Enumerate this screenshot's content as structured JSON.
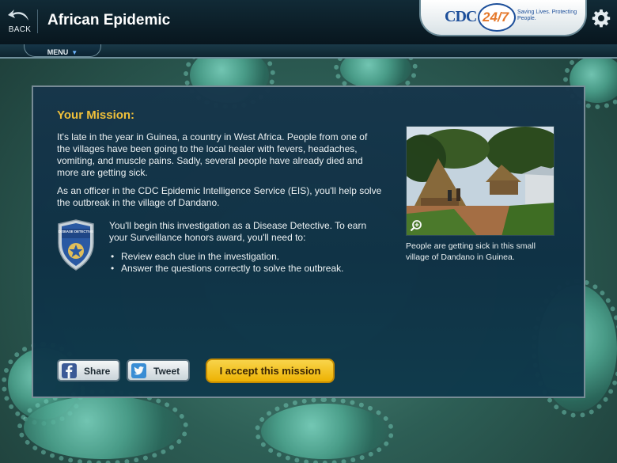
{
  "header": {
    "back_label": "BACK",
    "title": "African Epidemic",
    "logo": {
      "cdc": "CDC",
      "hours": "24/7",
      "tagline": "Saving Lives. Protecting People."
    },
    "menu_label": "MENU"
  },
  "mission": {
    "title": "Your Mission:",
    "paragraph1": "It's late in the year in Guinea, a country in West Africa. People from one of the villages have been going to the local healer with fevers, headaches, vomiting, and muscle pains. Sadly, several people have already died and more are getting sick.",
    "paragraph2": "As an officer in the CDC Epidemic Intelligence Service (EIS), you'll help solve the outbreak in the village of Dandano.",
    "badge_text": "DISEASE DETECTIVE",
    "paragraph3": "You'll begin this investigation as a Disease Detective. To earn your Surveillance honors award, you'll need to:",
    "bullets": [
      "Review each clue in the investigation.",
      "Answer the questions correctly to solve the outbreak."
    ],
    "photo_caption": "People are getting sick in this small village of Dandano in Guinea."
  },
  "actions": {
    "share_label": "Share",
    "tweet_label": "Tweet",
    "accept_label": "I accept this mission"
  },
  "colors": {
    "accent_yellow": "#f7c43a",
    "button_yellow": "#f3b400",
    "panel_bg": "#0f3145",
    "facebook_blue": "#3b5998",
    "twitter_blue": "#3a8fd9",
    "cdc_blue": "#1d4f9a",
    "cdc_orange": "#e5782a"
  },
  "icons": {
    "back": "back-arrow-icon",
    "settings": "gear-icon",
    "menu_caret": "caret-down-icon",
    "badge": "shield-badge-icon",
    "zoom": "zoom-icon",
    "facebook": "facebook-icon",
    "twitter": "twitter-icon"
  }
}
